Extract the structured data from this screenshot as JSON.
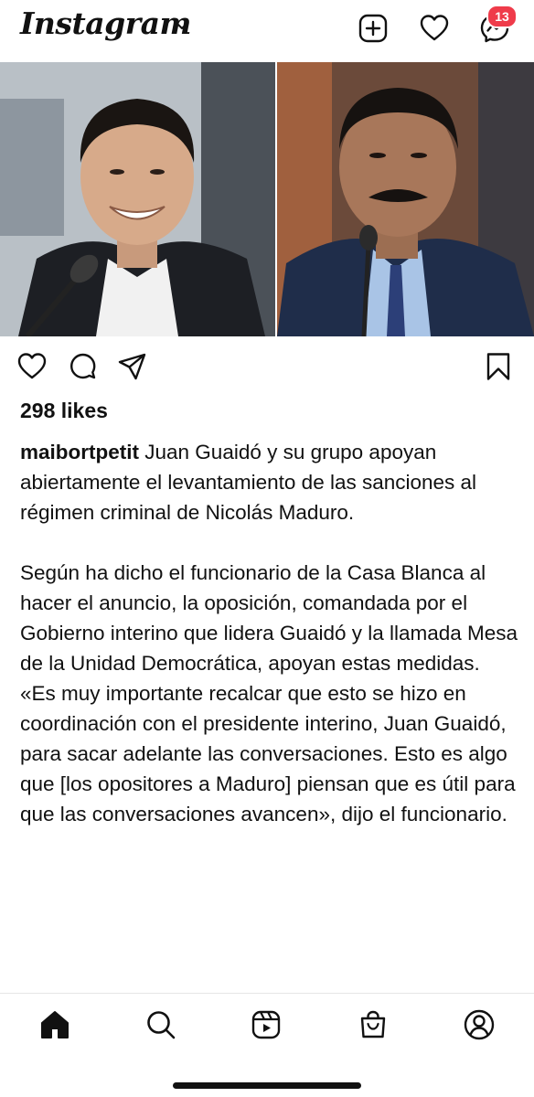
{
  "header": {
    "logo_text": "Instagram",
    "icons": [
      "plus-square-icon",
      "heart-icon",
      "messenger-icon"
    ],
    "notification_badge": "13",
    "badge_color": "#ef3b4a"
  },
  "post": {
    "likes": "298 likes",
    "username": "maibortpetit",
    "caption_first": " Juan Guaidó y su grupo apoyan abiertamente el levantamiento de las sanciones al régimen criminal de Nicolás Maduro.",
    "caption_p2": "Según ha dicho el funcionario de la Casa Blanca al hacer el anuncio, la oposición, comandada por el Gobierno interino que lidera Guaidó y la llamada Mesa de la Unidad Democrática, apoyan estas medidas.",
    "caption_p3": "«Es muy importante recalcar que esto se hizo en coordinación con el presidente interino, Juan Guaidó, para sacar adelante las conversaciones. Esto es algo que [los opositores a Maduro] piensan que es útil para que las conversaciones avancen», dijo el funcionario."
  },
  "bottom_nav": [
    "home-icon",
    "search-icon",
    "reels-icon",
    "shop-icon",
    "profile-icon"
  ]
}
